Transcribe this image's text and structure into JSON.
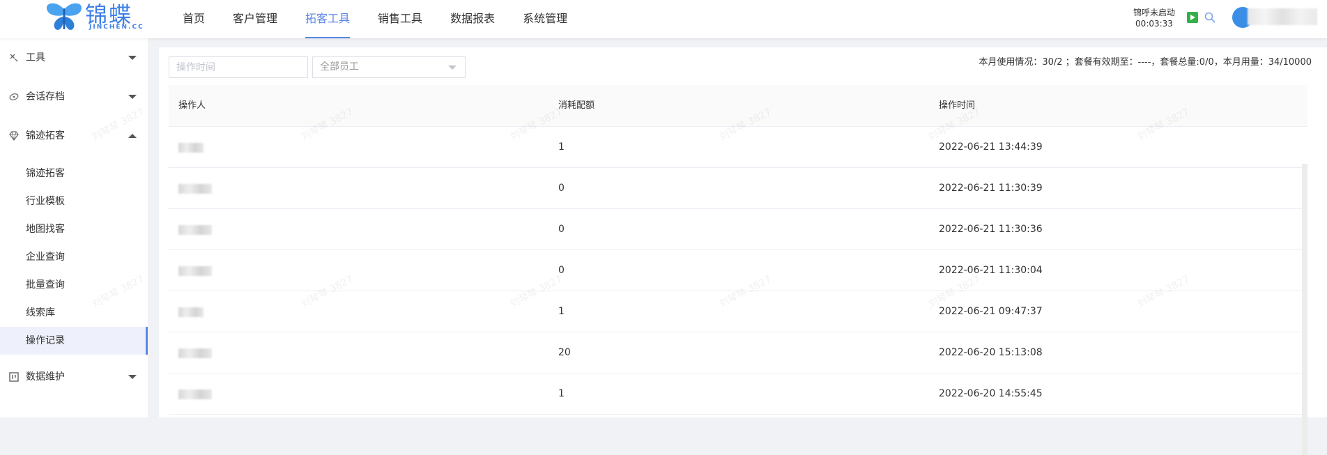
{
  "brand": {
    "name": "锦蝶",
    "sub": "JINCHEN.CC"
  },
  "nav": {
    "items": [
      {
        "label": "首页"
      },
      {
        "label": "客户管理"
      },
      {
        "label": "拓客工具"
      },
      {
        "label": "销售工具"
      },
      {
        "label": "数据报表"
      },
      {
        "label": "系统管理"
      }
    ],
    "active_index": 2
  },
  "call": {
    "status": "锦呼未启动",
    "timer": "00:03:33"
  },
  "sidebar": {
    "groups": [
      {
        "label": "工具",
        "icon": "tools-icon",
        "expanded": false
      },
      {
        "label": "会话存档",
        "icon": "chat-archive-icon",
        "expanded": false
      },
      {
        "label": "锦迹拓客",
        "icon": "diamond-icon",
        "expanded": true
      },
      {
        "label": "数据维护",
        "icon": "data-board-icon",
        "expanded": false
      }
    ],
    "sub_items": [
      {
        "label": "锦迹拓客"
      },
      {
        "label": "行业模板"
      },
      {
        "label": "地图找客"
      },
      {
        "label": "企业查询"
      },
      {
        "label": "批量查询"
      },
      {
        "label": "线索库"
      },
      {
        "label": "操作记录"
      }
    ],
    "active_sub_index": 6
  },
  "filters": {
    "time_placeholder": "操作时间",
    "employee_select": "全部员工"
  },
  "usage_text": "本月使用情况：30/2 ；套餐有效期至：----，套餐总量:0/0，本月用量：34/10000",
  "table": {
    "columns": [
      "操作人",
      "消耗配额",
      "操作时间"
    ],
    "rows": [
      {
        "quota": "1",
        "time": "2022-06-21 13:44:39"
      },
      {
        "quota": "0",
        "time": "2022-06-21 11:30:39"
      },
      {
        "quota": "0",
        "time": "2022-06-21 11:30:36"
      },
      {
        "quota": "0",
        "time": "2022-06-21 11:30:04"
      },
      {
        "quota": "1",
        "time": "2022-06-21 09:47:37"
      },
      {
        "quota": "20",
        "time": "2022-06-20 15:13:08"
      },
      {
        "quota": "1",
        "time": "2022-06-20 14:55:45"
      }
    ]
  },
  "watermark": "刘琴琴 3827",
  "colors": {
    "accent": "#5b86e5",
    "play": "#34b04a",
    "avatar": "#3a8ee6"
  }
}
